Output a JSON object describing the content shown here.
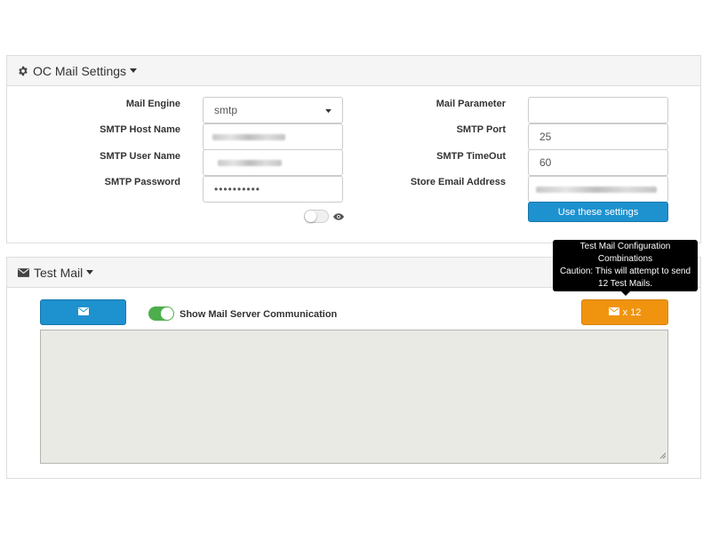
{
  "mail_settings": {
    "title": "OC Mail Settings",
    "labels": {
      "mail_engine": "Mail Engine",
      "smtp_host": "SMTP Host Name",
      "smtp_user": "SMTP User Name",
      "smtp_password": "SMTP Password",
      "mail_parameter": "Mail Parameter",
      "smtp_port": "SMTP Port",
      "smtp_timeout": "SMTP TimeOut",
      "store_email": "Store Email Address"
    },
    "values": {
      "mail_engine": "smtp",
      "smtp_password": "••••••••••",
      "mail_parameter": "",
      "smtp_port": "25",
      "smtp_timeout": "60"
    },
    "password_toggle_on": false,
    "use_settings_button": "Use these settings"
  },
  "test_mail": {
    "title": "Test Mail",
    "show_comm_label": "Show Mail Server Communication",
    "show_comm_on": true,
    "multi_button_suffix": "x 12",
    "tooltip": {
      "line1": "Test Mail Configuration",
      "line2": "Combinations",
      "line3": "Caution: This will attempt to send",
      "line4": "12 Test Mails."
    },
    "console_text": ""
  },
  "colors": {
    "primary": "#1e91cf",
    "warning": "#f0940f",
    "toggle_on": "#4cae4c",
    "console_bg": "#eaeae5"
  },
  "icons": [
    "gear-icon",
    "caret-down-icon",
    "envelope-icon",
    "chevron-down-icon",
    "eye-icon",
    "resize-grip-icon"
  ]
}
